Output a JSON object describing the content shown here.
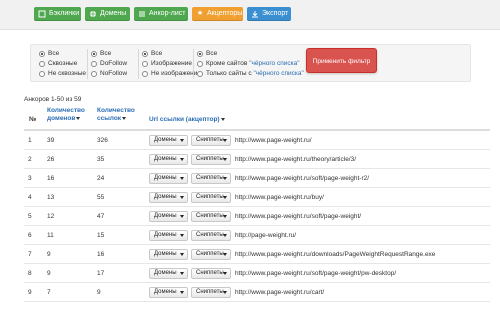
{
  "toolbar": {
    "buttons": [
      {
        "label": "Бэклинки",
        "icon": "backlinks-icon",
        "color": "#4fa84f"
      },
      {
        "label": "Домены",
        "icon": "globe-icon",
        "color": "#4fa84f"
      },
      {
        "label": "Анкор-лист",
        "icon": "list-icon",
        "color": "#4fa84f"
      },
      {
        "label": "Акцепторы",
        "icon": "star-icon",
        "color": "#f0a030"
      },
      {
        "label": "Экспорт",
        "icon": "download-icon",
        "color": "#3a8fd0"
      }
    ]
  },
  "filter": {
    "col1": [
      "Все",
      "Сквозные",
      "Не сквозные"
    ],
    "col2": [
      "Все",
      "DoFollow",
      "NoFollow"
    ],
    "col3": [
      "Все",
      "Изображение",
      "Не изображение"
    ],
    "col4": {
      "all": "Все",
      "except_prefix": "Кроме сайтов ",
      "only_prefix": "Только сайты с ",
      "blacklist": "\"чёрного списка\""
    },
    "apply_label": "Применить фильтр"
  },
  "anchors_count": "Анкоров 1-50 из 59",
  "table": {
    "headers": {
      "num": "№",
      "domains_count_line1": "Количество",
      "domains_count_line2": "доменов",
      "links_count_line1": "Количество",
      "links_count_line2": "ссылок",
      "url": "Url ссылки (акцептор)"
    },
    "dropdown_domains": "Домены",
    "dropdown_snippets": "Сниппеты",
    "rows": [
      {
        "num": "1",
        "domains": "39",
        "links": "326",
        "url": "http://www.page-weight.ru/"
      },
      {
        "num": "2",
        "domains": "26",
        "links": "35",
        "url": "http://www.page-weight.ru/theory/article/3/"
      },
      {
        "num": "3",
        "domains": "16",
        "links": "24",
        "url": "http://www.page-weight.ru/soft/page-weight-r2/"
      },
      {
        "num": "4",
        "domains": "13",
        "links": "55",
        "url": "http://www.page-weight.ru/buy/"
      },
      {
        "num": "5",
        "domains": "12",
        "links": "47",
        "url": "http://www.page-weight.ru/soft/page-weight/"
      },
      {
        "num": "6",
        "domains": "11",
        "links": "15",
        "url": "http://page-weight.ru/"
      },
      {
        "num": "7",
        "domains": "9",
        "links": "16",
        "url": "http://www.page-weight.ru/downloads/PageWeightRequestRange.exe"
      },
      {
        "num": "8",
        "domains": "9",
        "links": "17",
        "url": "http://www.page-weight.ru/soft/page-weight/pw-desktop/"
      },
      {
        "num": "9",
        "domains": "7",
        "links": "9",
        "url": "http://www.page-weight.ru/cart/"
      }
    ]
  }
}
